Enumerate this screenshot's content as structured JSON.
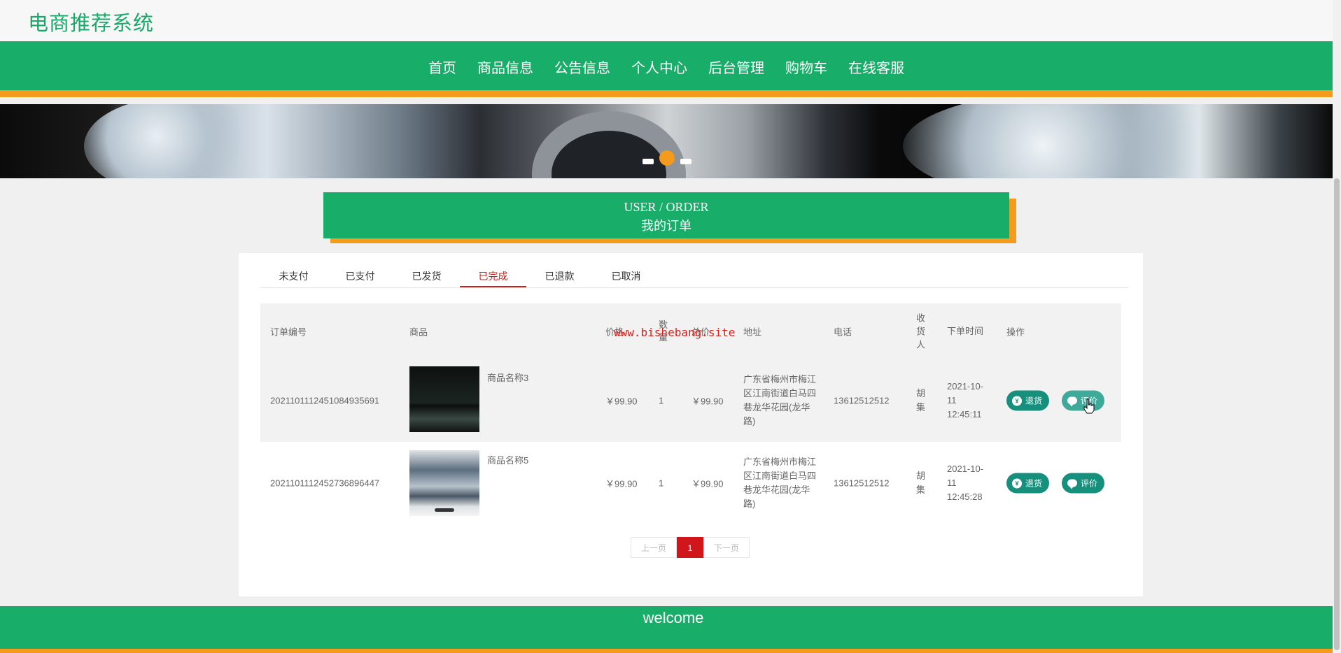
{
  "header": {
    "site_title": "电商推荐系统"
  },
  "nav": {
    "items": [
      "首页",
      "商品信息",
      "公告信息",
      "个人中心",
      "后台管理",
      "购物车",
      "在线客服"
    ]
  },
  "section_title": {
    "en": "USER / ORDER",
    "cn": "我的订单"
  },
  "tabs": {
    "items": [
      "未支付",
      "已支付",
      "已发货",
      "已完成",
      "已退款",
      "已取消"
    ],
    "active": "已完成"
  },
  "table": {
    "headers": {
      "order_no": "订单编号",
      "product": "商品",
      "price": "价格",
      "qty": "数量",
      "total": "总价",
      "address": "地址",
      "phone": "电话",
      "receiver": "收货人",
      "time": "下单时间",
      "action": "操作"
    },
    "rows": [
      {
        "order_no": "20211011124510849356​91",
        "product_name": "商品名称3",
        "price": "￥99.90",
        "qty": "1",
        "total": "￥99.90",
        "address": "广东省梅州市梅江区江南街道白马四巷龙华花园(龙华路)",
        "phone": "13612512512",
        "receiver": "胡集",
        "time": "2021-10-11 12:45:11"
      },
      {
        "order_no": "20211011124527368964​47",
        "product_name": "商品名称5",
        "price": "￥99.90",
        "qty": "1",
        "total": "￥99.90",
        "address": "广东省梅州市梅江区江南街道白马四巷龙华花园(龙华路)",
        "phone": "13612512512",
        "receiver": "胡集",
        "time": "2021-10-11 12:45:28"
      }
    ],
    "actions": {
      "refund": "退货",
      "review": "评价"
    }
  },
  "watermark": "www.bishebang.site",
  "pagination": {
    "prev": "上一页",
    "current": "1",
    "next": "下一页"
  },
  "footer": {
    "text": "welcome"
  },
  "colors": {
    "brand_green": "#19ad6a",
    "accent_orange": "#f49a1c",
    "active_red": "#c4231b",
    "button_teal": "#168f7d"
  }
}
